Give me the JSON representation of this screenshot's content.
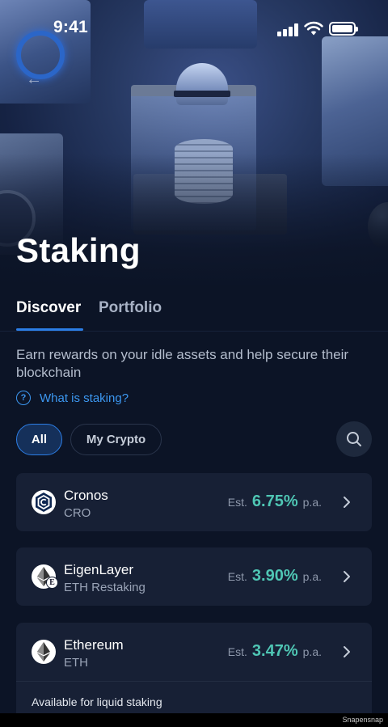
{
  "status_bar": {
    "time": "9:41"
  },
  "header": {
    "title": "Staking"
  },
  "tabs": [
    {
      "label": "Discover",
      "active": true
    },
    {
      "label": "Portfolio",
      "active": false
    }
  ],
  "intro": {
    "description": "Earn rewards on your idle assets and help secure their blockchain",
    "help_link": "What is staking?"
  },
  "filters": [
    {
      "label": "All",
      "selected": true
    },
    {
      "label": "My Crypto",
      "selected": false
    }
  ],
  "assets": [
    {
      "name": "Cronos",
      "ticker": "CRO",
      "est_label": "Est.",
      "rate": "6.75%",
      "pa_label": "p.a.",
      "icon": "cronos-icon"
    },
    {
      "name": "EigenLayer",
      "ticker": "ETH Restaking",
      "est_label": "Est.",
      "rate": "3.90%",
      "pa_label": "p.a.",
      "icon": "eigenlayer-icon"
    },
    {
      "name": "Ethereum",
      "ticker": "ETH",
      "est_label": "Est.",
      "rate": "3.47%",
      "pa_label": "p.a.",
      "icon": "ethereum-icon",
      "note": "Available for liquid staking"
    }
  ],
  "colors": {
    "accent": "#2c7ee6",
    "rate": "#4fc6b4",
    "background": "#0c1426",
    "card": "#172035"
  },
  "watermark": "Snapensnap"
}
